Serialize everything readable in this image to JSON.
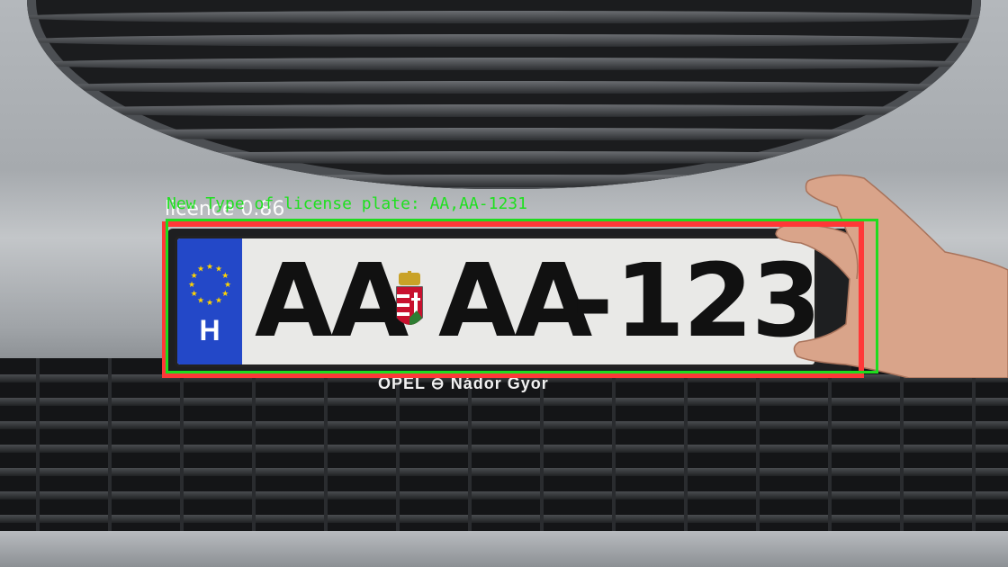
{
  "scene": {
    "description_hidden": false
  },
  "plate": {
    "country_code": "H",
    "left_part": "AA",
    "middle_part": "AA",
    "separator": "-",
    "right_part": "123"
  },
  "dealer_text": "OPEL ⊖ Nádor Gyor",
  "detections": {
    "red": {
      "label": "licence 0.86",
      "color": "#ff3838"
    },
    "green": {
      "label": "New Type of license plate: AA,AA-1231",
      "color": "#1fdc1f"
    }
  }
}
